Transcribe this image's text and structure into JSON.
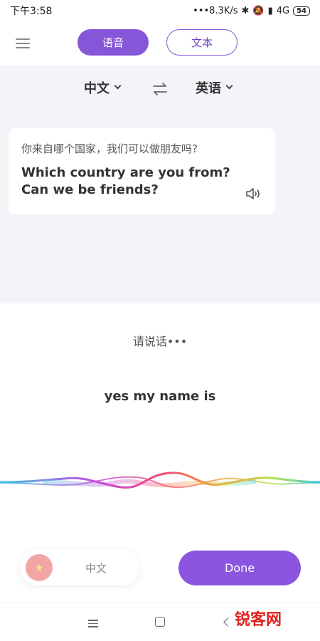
{
  "status_bar": {
    "time": "下午3:58",
    "network_speed": "•••8.3K/s",
    "network_type": "4G",
    "battery": "54"
  },
  "header": {
    "tab_voice": "语音",
    "tab_text": "文本"
  },
  "languages": {
    "source": "中文",
    "target": "英语"
  },
  "translation_card": {
    "source_text": "你来自哪个国家，我们可以做朋友吗?",
    "translated_text": "Which country are you from? Can we be friends?"
  },
  "voice": {
    "prompt": "请说话•••",
    "recognized_text": "yes my name is"
  },
  "bottom": {
    "language_label": "中文",
    "done_label": "Done"
  },
  "watermark": "锐客网",
  "colors": {
    "accent": "#8556d8",
    "background_gray": "#f4f3f8"
  },
  "icons": [
    "menu-icon",
    "swap-icon",
    "chevron-down-icon",
    "speaker-icon",
    "china-flag-icon",
    "nav-menu-icon",
    "nav-home-icon",
    "nav-back-icon"
  ]
}
